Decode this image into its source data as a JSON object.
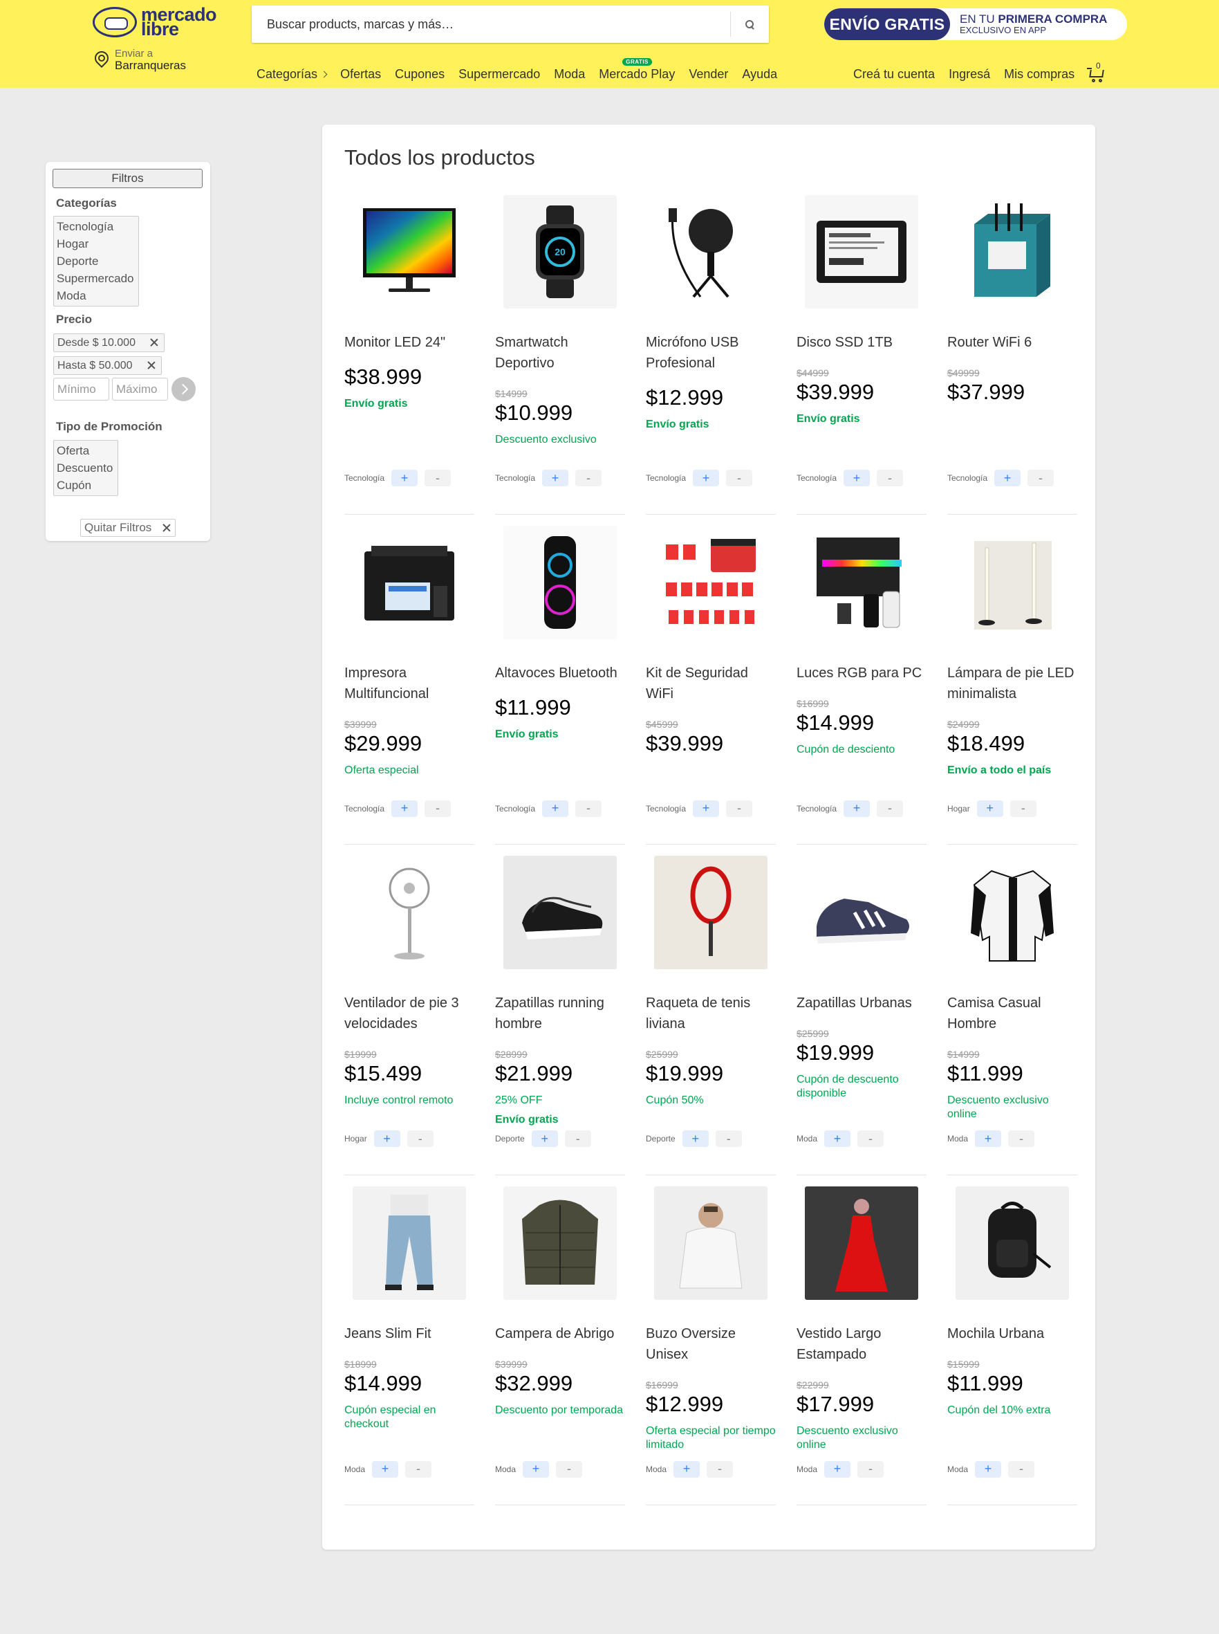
{
  "header": {
    "logo": "mercado libre",
    "location_label": "Enviar a",
    "location_city": "Barranqueras",
    "search_placeholder": "Buscar products, marcas y más…",
    "promo_left": "ENVÍO GRATIS",
    "promo_line1_prefix": "EN TU ",
    "promo_line1_bold": "PRIMERA COMPRA",
    "promo_line2": "EXCLUSIVO EN APP",
    "nav": [
      "Categorías",
      "Ofertas",
      "Cupones",
      "Supermercado",
      "Moda",
      "Mercado Play",
      "Vender",
      "Ayuda"
    ],
    "nav_badge": "GRATIS",
    "nav_right": [
      "Creá tu cuenta",
      "Ingresá",
      "Mis compras"
    ],
    "cart_count": "0",
    "accent": "#fff159"
  },
  "sidebar": {
    "filters_button": "Filtros",
    "categories_title": "Categorías",
    "categories": [
      "Tecnología",
      "Hogar",
      "Deporte",
      "Supermercado",
      "Moda"
    ],
    "price_title": "Precio",
    "price_from_chip": "Desde $ 10.000",
    "price_to_chip": "Hasta $ 50.000",
    "min_placeholder": "Mínimo",
    "max_placeholder": "Máximo",
    "promo_title": "Tipo de Promoción",
    "promos": [
      "Oferta",
      "Descuento",
      "Cupón"
    ],
    "clear_button": "Quitar Filtros"
  },
  "main": {
    "title": "Todos los productos",
    "plus_label": "+",
    "minus_label": "-",
    "products": [
      {
        "title": "Monitor LED 24\"",
        "old": "",
        "price": "$38.999",
        "promo": "",
        "shipping": "Envío gratis",
        "category": "Tecnología",
        "icon": "monitor-icon"
      },
      {
        "title": "Smartwatch Deportivo",
        "old": "$14999",
        "price": "$10.999",
        "promo": "Descuento exclusivo",
        "shipping": "",
        "category": "Tecnología",
        "icon": "smartwatch-icon"
      },
      {
        "title": "Micrófono USB Profesional",
        "old": "",
        "price": "$12.999",
        "promo": "",
        "shipping": "Envío gratis",
        "category": "Tecnología",
        "icon": "microphone-icon"
      },
      {
        "title": "Disco SSD 1TB",
        "old": "$44999",
        "price": "$39.999",
        "promo": "",
        "shipping": "Envío gratis",
        "category": "Tecnología",
        "icon": "ssd-icon"
      },
      {
        "title": "Router WiFi 6",
        "old": "$49999",
        "price": "$37.999",
        "promo": "",
        "shipping": "",
        "category": "Tecnología",
        "icon": "router-icon"
      },
      {
        "title": "Impresora Multifuncional",
        "old": "$39999",
        "price": "$29.999",
        "promo": "Oferta especial",
        "shipping": "",
        "category": "Tecnología",
        "icon": "printer-icon"
      },
      {
        "title": "Altavoces Bluetooth",
        "old": "",
        "price": "$11.999",
        "promo": "",
        "shipping": "Envío gratis",
        "category": "Tecnología",
        "icon": "speaker-icon"
      },
      {
        "title": "Kit de Seguridad WiFi",
        "old": "$45999",
        "price": "$39.999",
        "promo": "",
        "shipping": "",
        "category": "Tecnología",
        "icon": "lock-kit-icon"
      },
      {
        "title": "Luces RGB para PC",
        "old": "$16999",
        "price": "$14.999",
        "promo": "Cupón de desciento",
        "shipping": "",
        "category": "Tecnología",
        "icon": "rgb-lights-icon"
      },
      {
        "title": "Lámpara de pie LED minimalista",
        "old": "$24999",
        "price": "$18.499",
        "promo": "",
        "shipping": "Envío a todo el país",
        "category": "Hogar",
        "icon": "floor-lamp-icon"
      },
      {
        "title": "Ventilador de pie 3 velocidades",
        "old": "$19999",
        "price": "$15.499",
        "promo": "Incluye control remoto",
        "shipping": "",
        "category": "Hogar",
        "icon": "fan-icon"
      },
      {
        "title": "Zapatillas running hombre",
        "old": "$28999",
        "price": "$21.999",
        "promo": "25% OFF",
        "shipping": "Envío gratis",
        "category": "Deporte",
        "icon": "running-shoes-icon"
      },
      {
        "title": "Raqueta de tenis liviana",
        "old": "$25999",
        "price": "$19.999",
        "promo": "Cupón 50%",
        "shipping": "",
        "category": "Deporte",
        "icon": "tennis-racket-icon"
      },
      {
        "title": "Zapatillas Urbanas",
        "old": "$25999",
        "price": "$19.999",
        "promo": "Cupón de descuento disponible",
        "shipping": "",
        "category": "Moda",
        "icon": "sneakers-icon"
      },
      {
        "title": "Camisa Casual Hombre",
        "old": "$14999",
        "price": "$11.999",
        "promo": "Descuento exclusivo online",
        "shipping": "",
        "category": "Moda",
        "icon": "shirt-icon"
      },
      {
        "title": "Jeans Slim Fit",
        "old": "$18999",
        "price": "$14.999",
        "promo": "Cupón especial en checkout",
        "shipping": "",
        "category": "Moda",
        "icon": "jeans-icon"
      },
      {
        "title": "Campera de Abrigo",
        "old": "$39999",
        "price": "$32.999",
        "promo": "Descuento por temporada",
        "shipping": "",
        "category": "Moda",
        "icon": "jacket-icon"
      },
      {
        "title": "Buzo Oversize Unisex",
        "old": "$16999",
        "price": "$12.999",
        "promo": "Oferta especial por tiempo limitado",
        "shipping": "",
        "category": "Moda",
        "icon": "hoodie-icon"
      },
      {
        "title": "Vestido Largo Estampado",
        "old": "$22999",
        "price": "$17.999",
        "promo": "Descuento exclusivo online",
        "shipping": "",
        "category": "Moda",
        "icon": "dress-icon"
      },
      {
        "title": "Mochila Urbana",
        "old": "$15999",
        "price": "$11.999",
        "promo": "Cupón del 10% extra",
        "shipping": "",
        "category": "Moda",
        "icon": "backpack-icon"
      }
    ]
  }
}
